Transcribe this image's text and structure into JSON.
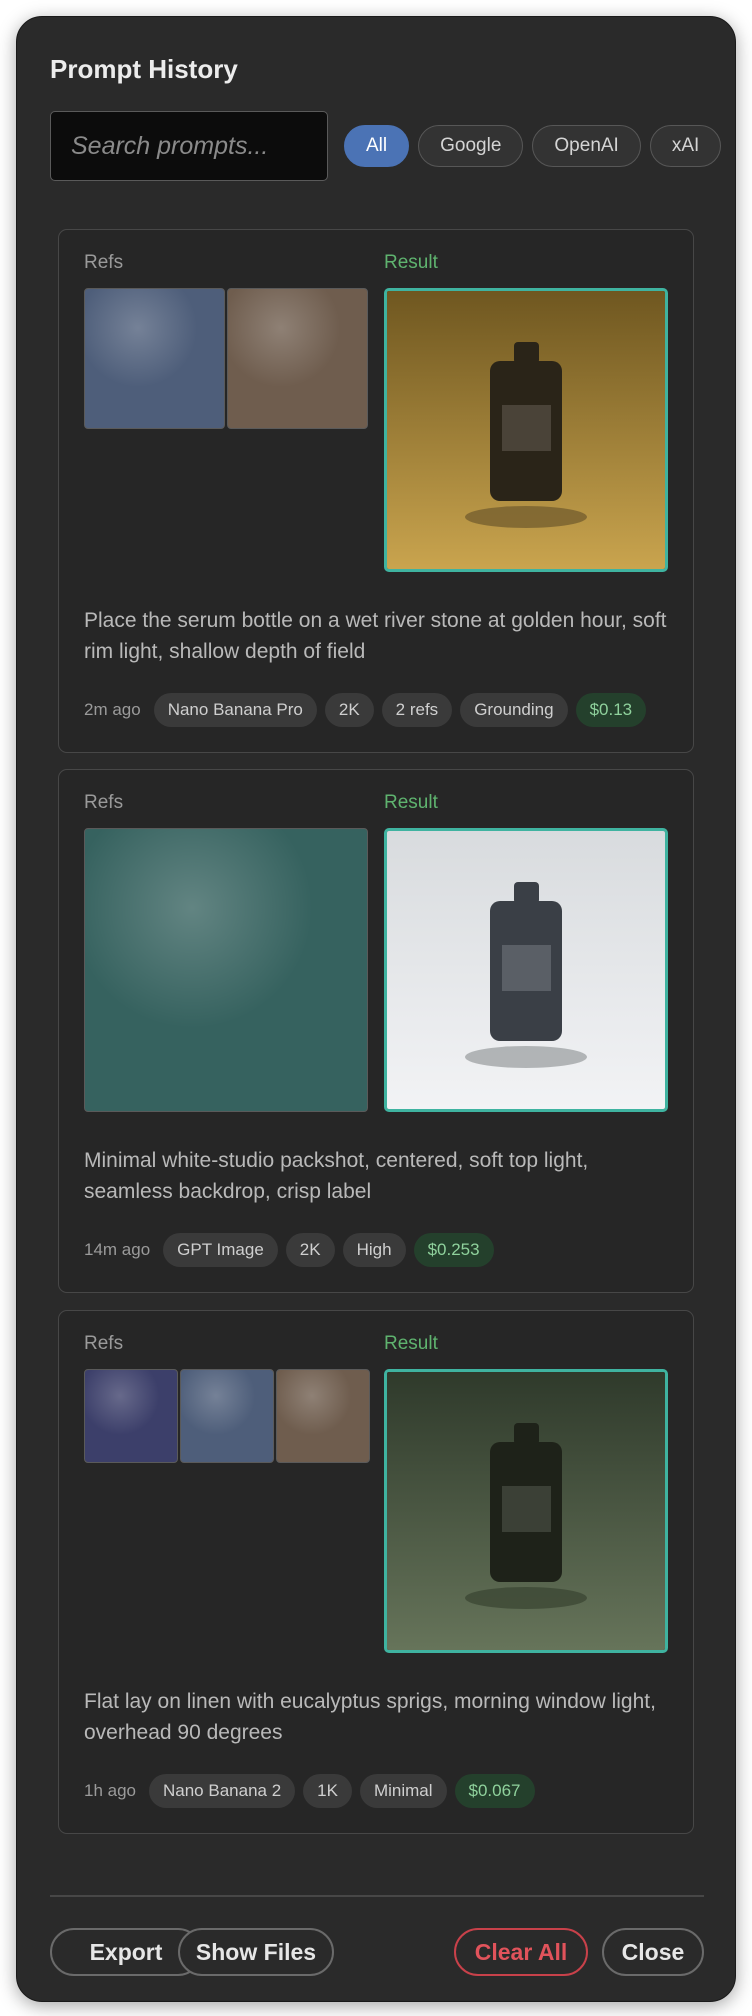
{
  "header": {
    "title": "Prompt History"
  },
  "search": {
    "placeholder": "Search prompts..."
  },
  "filters": [
    {
      "label": "All",
      "active": true
    },
    {
      "label": "Google",
      "active": false
    },
    {
      "label": "OpenAI",
      "active": false
    },
    {
      "label": "xAI",
      "active": false
    }
  ],
  "labels": {
    "refs": "Refs",
    "result": "Result"
  },
  "entries": [
    {
      "prompt": "Place the serum bottle on a wet river stone at golden hour, soft rim light, shallow depth of field",
      "time": "2m ago",
      "tags": [
        "Nano Banana Pro",
        "2K",
        "2 refs",
        "Grounding"
      ],
      "cost": "$0.13",
      "refs": [
        {
          "color": "#4e5e7a"
        },
        {
          "color": "#6f5d4e"
        }
      ],
      "result": {
        "bg_top": "#6f5720",
        "bg_bottom": "#c9a44e",
        "bottle": "#2a2418",
        "label": "#4a4338",
        "shadow": "#7a6330"
      }
    },
    {
      "prompt": "Minimal white-studio packshot, centered, soft top light, seamless backdrop, crisp label",
      "time": "14m ago",
      "tags": [
        "GPT Image",
        "2K",
        "High"
      ],
      "cost": "$0.253",
      "refs": [
        {
          "color": "#36625f"
        }
      ],
      "result": {
        "bg_top": "#d8dbde",
        "bg_bottom": "#f2f3f5",
        "bottle": "#3a3f46",
        "label": "#5a5f66",
        "shadow": "#a6a9ac"
      }
    },
    {
      "prompt": "Flat lay on linen with eucalyptus sprigs, morning window light, overhead 90 degrees",
      "time": "1h ago",
      "tags": [
        "Nano Banana 2",
        "1K",
        "Minimal"
      ],
      "cost": "$0.067",
      "refs": [
        {
          "color": "#3c3f6a"
        },
        {
          "color": "#4e5e7a"
        },
        {
          "color": "#6f5d4e"
        }
      ],
      "result": {
        "bg_top": "#2f3a2b",
        "bg_bottom": "#66745a",
        "bottle": "#1e2219",
        "label": "#3b4036",
        "shadow": "#3e4a36"
      }
    }
  ],
  "footer": {
    "export": "Export",
    "show_files": "Show Files",
    "clear_all": "Clear All",
    "close": "Close"
  }
}
